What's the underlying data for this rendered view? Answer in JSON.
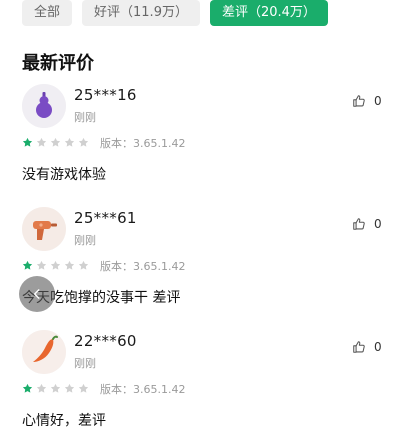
{
  "tabs": [
    {
      "label": "全部",
      "active": false
    },
    {
      "label": "好评（11.9万）",
      "active": false
    },
    {
      "label": "差评（20.4万）",
      "active": true
    }
  ],
  "section_title": "最新评价",
  "colors": {
    "accent": "#1aad6b",
    "star_filled": "#1aad6b",
    "star_empty": "#d0d0d0"
  },
  "reviews": [
    {
      "username": "25***16",
      "time": "刚刚",
      "version": "版本：3.65.1.42",
      "rating": 1,
      "max_rating": 5,
      "likes": "0",
      "content": "没有游戏体验",
      "avatar_icon": "purple-gourd-icon"
    },
    {
      "username": "25***61",
      "time": "刚刚",
      "version": "版本：3.65.1.42",
      "rating": 1,
      "max_rating": 5,
      "likes": "0",
      "content": "今天吃饱撑的没事干  差评",
      "avatar_icon": "orange-drill-icon"
    },
    {
      "username": "22***60",
      "time": "刚刚",
      "version": "版本：3.65.1.42",
      "rating": 1,
      "max_rating": 5,
      "likes": "0",
      "content": "心情好，差评",
      "avatar_icon": "orange-chili-icon"
    }
  ],
  "float_button_icon": "chevron-left-icon"
}
